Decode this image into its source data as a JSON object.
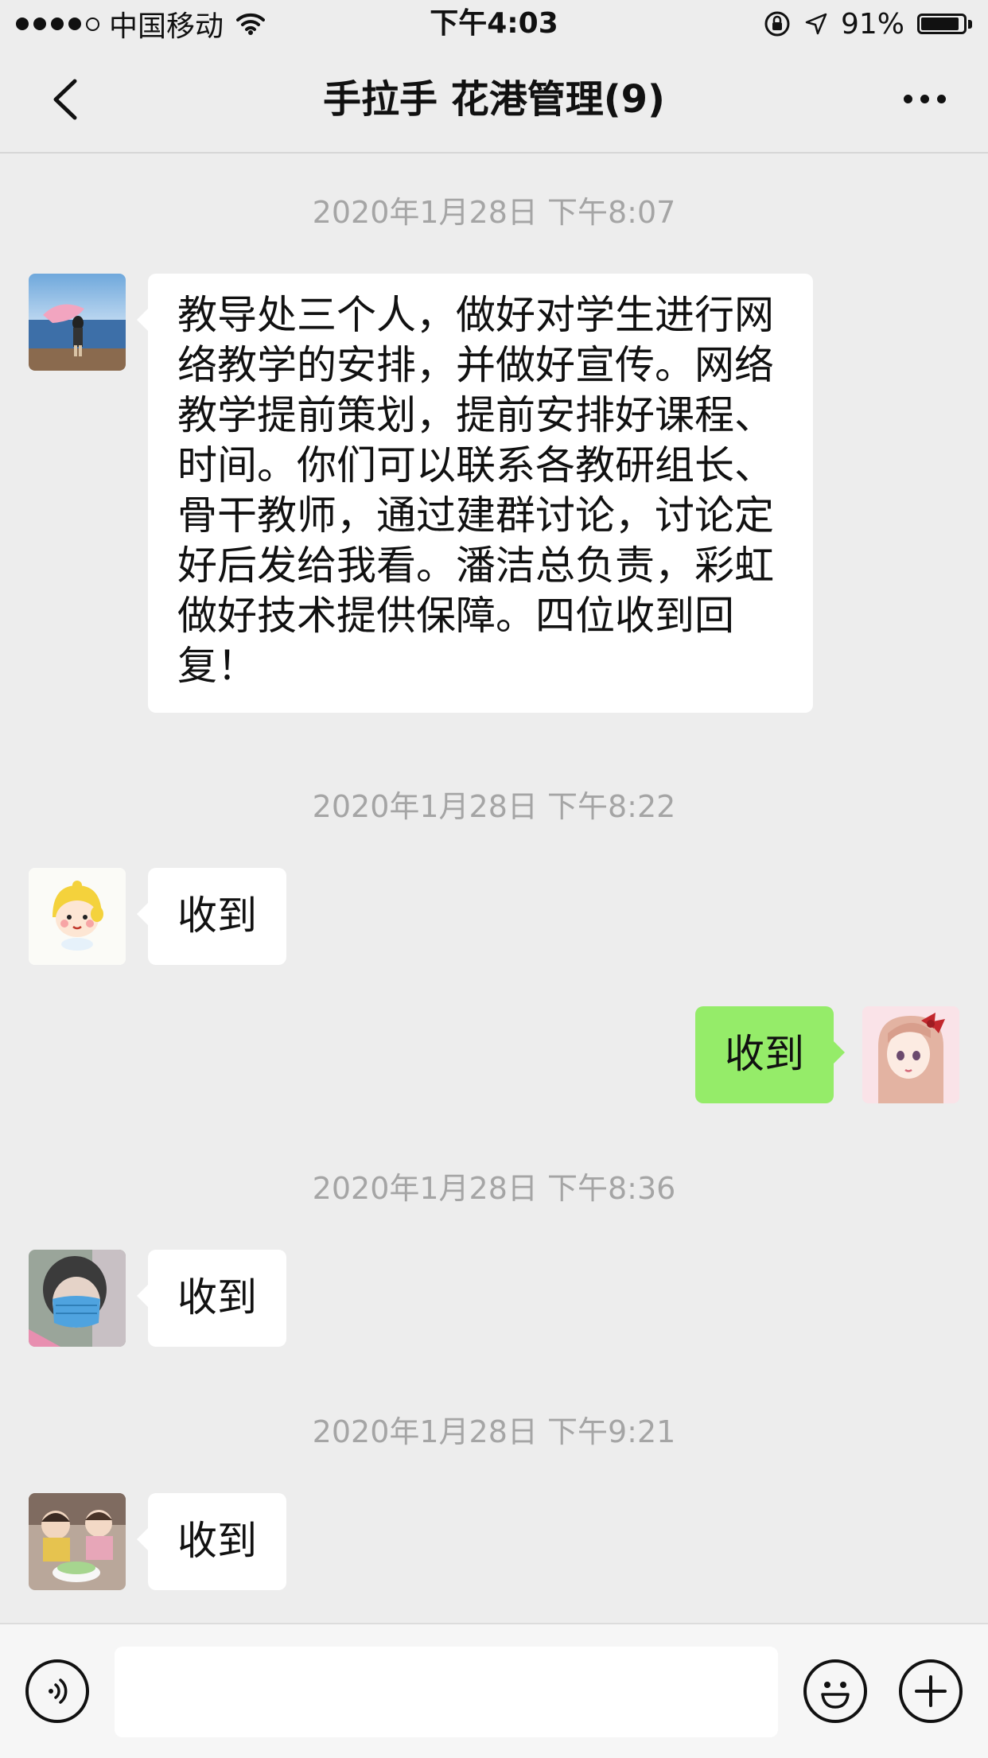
{
  "status_bar": {
    "carrier": "中国移动",
    "time": "下午4:03",
    "battery": "91%",
    "battery_level": 0.91,
    "icons": [
      "signal-dots-icon",
      "wifi-icon",
      "orientation-lock-icon",
      "location-arrow-icon",
      "battery-icon"
    ]
  },
  "header": {
    "title": "手拉手 花港管理(9)",
    "back_icon": "chevron-left-icon",
    "more_icon": "ellipsis-icon"
  },
  "messages": [
    {
      "timestamp": "2020年1月28日 下午8:07",
      "side": "left",
      "avatar": "avatar-girl-by-lake",
      "text": "教导处三个人，做好对学生进行网络教学的安排，并做好宣传。网络教学提前策划，提前安排好课程、时间。你们可以联系各教研组长、骨干教师，通过建群讨论，讨论定好后发给我看。潘洁总负责，彩虹做好技术提供保障。四位收到回复！"
    },
    {
      "timestamp": "2020年1月28日 下午8:22",
      "side": "left",
      "avatar": "avatar-cartoon-child-yellow-hat",
      "text": "收到"
    },
    {
      "side": "right",
      "avatar": "avatar-anime-girl-red-bow",
      "text": "收到"
    },
    {
      "timestamp": "2020年1月28日 下午8:36",
      "side": "left",
      "avatar": "avatar-person-blue-mask",
      "text": "收到"
    },
    {
      "timestamp": "2020年1月28日 下午9:21",
      "side": "left",
      "avatar": "avatar-two-kids-with-cake",
      "text": "收到"
    }
  ],
  "input_bar": {
    "voice_icon": "voice-icon",
    "input_value": "",
    "emoji_icon": "emoji-icon",
    "add_icon": "plus-circle-icon"
  },
  "colors": {
    "background": "#ededed",
    "incoming_bubble": "#ffffff",
    "outgoing_bubble": "#95ec69",
    "timestamp_text": "#a5a5a5"
  }
}
